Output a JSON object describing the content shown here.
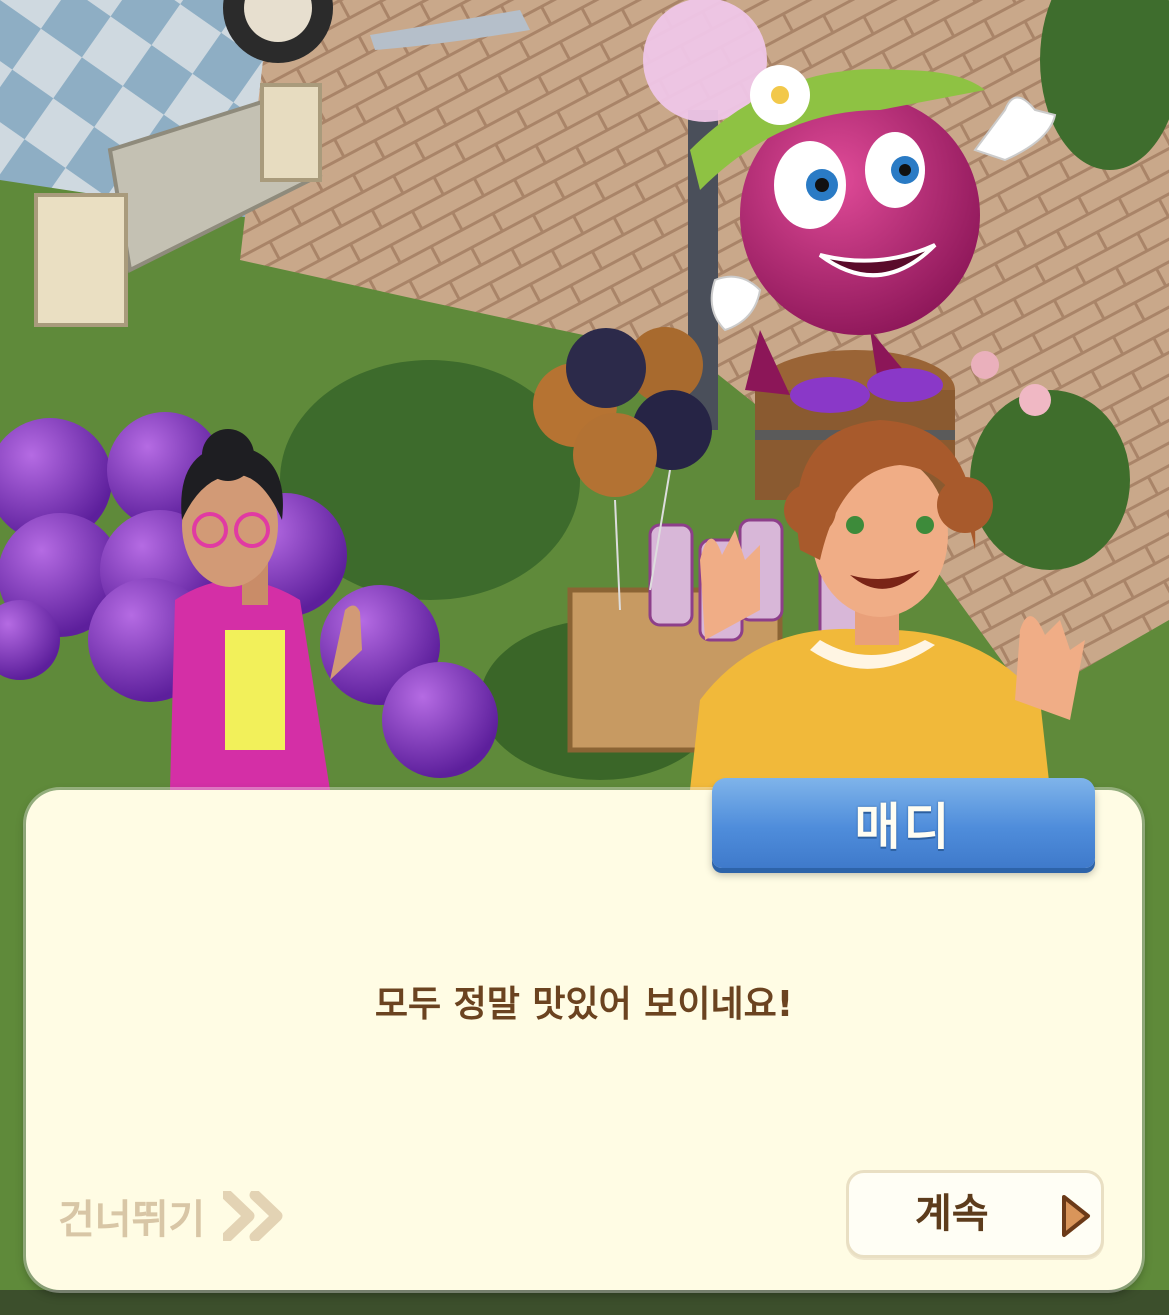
{
  "dialog": {
    "speaker_name": "매디",
    "text": "모두 정말 맛있어 보이네요!",
    "skip_label": "건너뛰기",
    "continue_label": "계속"
  },
  "icons": {
    "skip": "double-chevron-right-icon",
    "continue": "play-triangle-icon"
  },
  "colors": {
    "dialog_bg": "#fffce4",
    "nameplate": "#4f8ddb",
    "text": "#6b4320",
    "skip_text": "#d8c6a6",
    "continue_arrow": "#d9955a"
  }
}
